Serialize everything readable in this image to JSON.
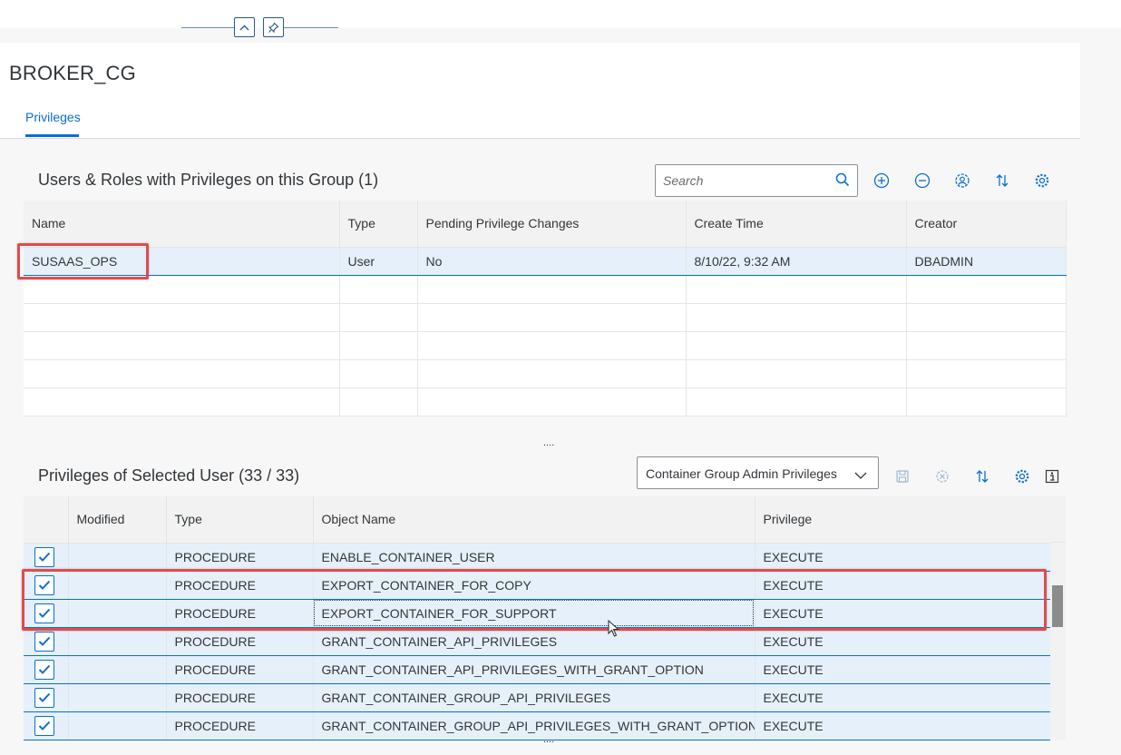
{
  "page": {
    "title": "BROKER_CG",
    "tab": "Privileges"
  },
  "users_section": {
    "title": "Users & Roles with Privileges on this Group (1)",
    "search_placeholder": "Search",
    "columns": [
      "Name",
      "Type",
      "Pending Privilege Changes",
      "Create Time",
      "Creator"
    ],
    "rows": [
      {
        "name": "SUSAAS_OPS",
        "type": "User",
        "pending": "No",
        "create_time": "8/10/22, 9:32 AM",
        "creator": "DBADMIN"
      }
    ],
    "icons": [
      "search-icon",
      "add-icon",
      "remove-icon",
      "user-settings-icon",
      "sort-icon",
      "settings-icon"
    ]
  },
  "privileges_section": {
    "title": "Privileges of Selected User (33 / 33)",
    "filter_value": "Container Group Admin Privileges",
    "columns": [
      "",
      "Modified",
      "Type",
      "Object Name",
      "Privilege"
    ],
    "rows": [
      {
        "checked": true,
        "modified": "",
        "type": "PROCEDURE",
        "object": "ENABLE_CONTAINER_USER",
        "privilege": "EXECUTE"
      },
      {
        "checked": true,
        "modified": "",
        "type": "PROCEDURE",
        "object": "EXPORT_CONTAINER_FOR_COPY",
        "privilege": "EXECUTE"
      },
      {
        "checked": true,
        "modified": "",
        "type": "PROCEDURE",
        "object": "EXPORT_CONTAINER_FOR_SUPPORT",
        "privilege": "EXECUTE"
      },
      {
        "checked": true,
        "modified": "",
        "type": "PROCEDURE",
        "object": "GRANT_CONTAINER_API_PRIVILEGES",
        "privilege": "EXECUTE"
      },
      {
        "checked": true,
        "modified": "",
        "type": "PROCEDURE",
        "object": "GRANT_CONTAINER_API_PRIVILEGES_WITH_GRANT_OPTION",
        "privilege": "EXECUTE"
      },
      {
        "checked": true,
        "modified": "",
        "type": "PROCEDURE",
        "object": "GRANT_CONTAINER_GROUP_API_PRIVILEGES",
        "privilege": "EXECUTE"
      },
      {
        "checked": true,
        "modified": "",
        "type": "PROCEDURE",
        "object": "GRANT_CONTAINER_GROUP_API_PRIVILEGES_WITH_GRANT_OPTION",
        "privilege": "EXECUTE"
      }
    ],
    "icons": [
      "save-icon",
      "discard-icon",
      "sort-icon",
      "settings-icon",
      "info-icon"
    ]
  },
  "resize_handle": "....",
  "colors": {
    "accent": "#0a6ed1",
    "selected_row": "#e5f0fa",
    "highlight_box": "#e24b4b"
  }
}
